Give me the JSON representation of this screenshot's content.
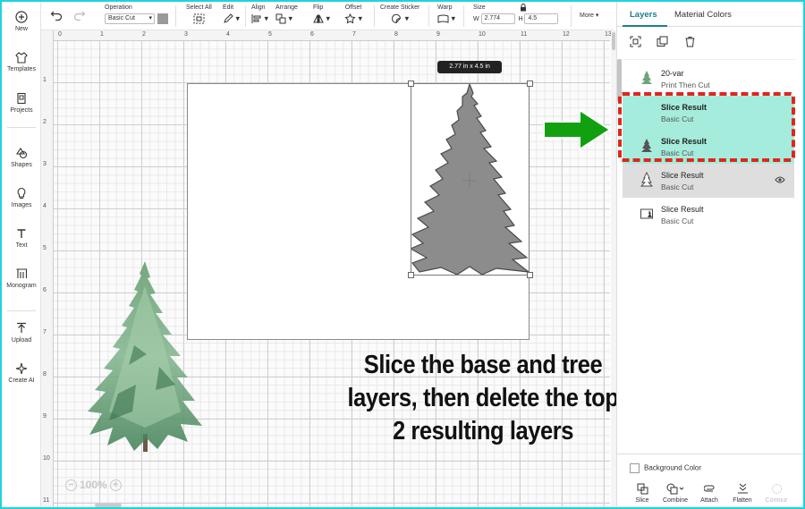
{
  "leftnav": {
    "items": [
      {
        "label": "New",
        "icon": "plus-circle-icon"
      },
      {
        "label": "Templates",
        "icon": "shirt-icon"
      },
      {
        "label": "Projects",
        "icon": "projects-icon"
      },
      {
        "label": "Shapes",
        "icon": "shapes-icon"
      },
      {
        "label": "Images",
        "icon": "bulb-icon"
      },
      {
        "label": "Text",
        "icon": "text-icon"
      },
      {
        "label": "Monogram",
        "icon": "monogram-icon"
      },
      {
        "label": "Upload",
        "icon": "upload-icon"
      },
      {
        "label": "Create AI",
        "icon": "sparkle-icon"
      }
    ]
  },
  "toolbar": {
    "operation_label": "Operation",
    "operation_value": "Basic Cut",
    "operation_color": "#9a9a9a",
    "select_all_label": "Select All",
    "edit_label": "Edit",
    "align_label": "Align",
    "arrange_label": "Arrange",
    "flip_label": "Flip",
    "offset_label": "Offset",
    "create_sticker_label": "Create Sticker",
    "warp_label": "Warp",
    "size_label": "Size",
    "w_label": "W",
    "w_value": "2.774",
    "h_label": "H",
    "h_value": "4.5",
    "more_label": "More"
  },
  "rulers": {
    "top": [
      "0",
      "1",
      "2",
      "3",
      "4",
      "5",
      "6",
      "7",
      "8",
      "9",
      "10",
      "11",
      "12",
      "13"
    ],
    "left": [
      "1",
      "2",
      "3",
      "4",
      "5",
      "6",
      "7",
      "8",
      "9",
      "10",
      "11"
    ]
  },
  "canvas": {
    "size_tooltip": "2.77  in x 4.5  in",
    "zoom": "100%",
    "caption_lines": [
      "Slice the base and tree",
      "layers, then delete the top",
      "2 resulting layers"
    ],
    "caption_color": "#111111"
  },
  "panel": {
    "tabs": [
      "Layers",
      "Material Colors"
    ],
    "active_tab": "Layers",
    "accent": "#1b7f86",
    "highlight_color": "#a5ecdc",
    "callout_color": "#e1251b",
    "arrow_color": "#10a010",
    "layers": [
      {
        "name": "20-var",
        "operation": "Print Then Cut",
        "state": "normal"
      },
      {
        "name": "Slice Result",
        "operation": "Basic Cut",
        "state": "highlighted"
      },
      {
        "name": "Slice Result",
        "operation": "Basic Cut",
        "state": "highlighted"
      },
      {
        "name": "Slice Result",
        "operation": "Basic Cut",
        "state": "selected"
      },
      {
        "name": "Slice Result",
        "operation": "Basic Cut",
        "state": "normal"
      }
    ],
    "background_color_label": "Background Color",
    "actions": [
      "Slice",
      "Combine",
      "Attach",
      "Flatten",
      "Contour"
    ]
  }
}
